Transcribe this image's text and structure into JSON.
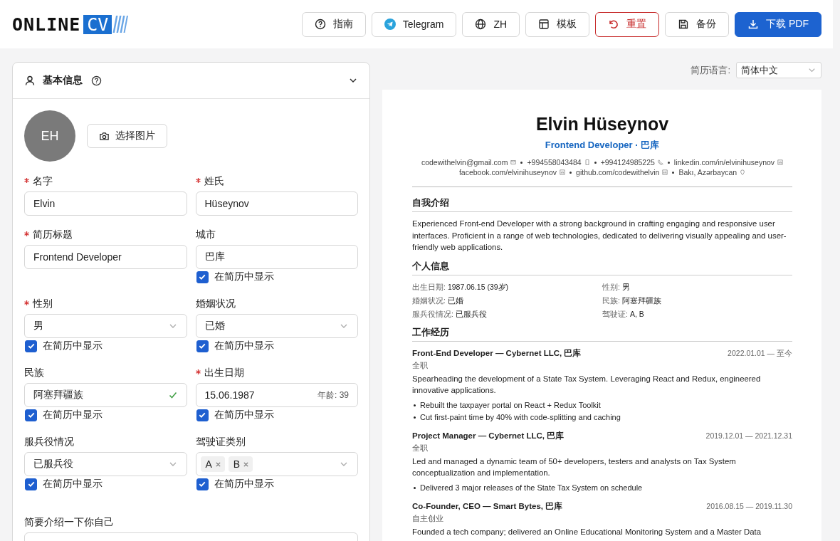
{
  "logo": {
    "text": "ONLINE",
    "highlight": "CV"
  },
  "toolbar": [
    {
      "label": "指南",
      "kind": "default"
    },
    {
      "label": "Telegram",
      "kind": "default"
    },
    {
      "label": "ZH",
      "kind": "default"
    },
    {
      "label": "模板",
      "kind": "default"
    },
    {
      "label": "重置",
      "kind": "danger"
    },
    {
      "label": "备份",
      "kind": "default"
    },
    {
      "label": "下载 PDF",
      "kind": "primary"
    }
  ],
  "card": {
    "title": "基本信息",
    "expanded": true,
    "avatar": "EH",
    "photo_button": "选择图片"
  },
  "form": {
    "fields": [
      {
        "label": "名字",
        "required": true,
        "kind": "text",
        "value": "Elvin",
        "valid": false
      },
      {
        "label": "姓氏",
        "required": true,
        "kind": "text",
        "value": "Hüseynov",
        "valid": false
      },
      {
        "label": "简历标题",
        "required": true,
        "kind": "text",
        "value": "Frontend Developer",
        "valid": false
      },
      {
        "label": "城市",
        "required": false,
        "kind": "text",
        "value": "巴库",
        "valid": false,
        "show": {
          "label": "在简历中显示",
          "checked": true
        }
      },
      {
        "label": "性别",
        "required": true,
        "kind": "select",
        "value": "男",
        "show": {
          "label": "在简历中显示",
          "checked": true
        }
      },
      {
        "label": "婚姻状况",
        "required": false,
        "kind": "select",
        "value": "已婚",
        "show": {
          "label": "在简历中显示",
          "checked": true
        }
      },
      {
        "label": "民族",
        "required": false,
        "kind": "text",
        "value": "阿塞拜疆族",
        "valid": true,
        "show": {
          "label": "在简历中显示",
          "checked": true
        }
      },
      {
        "label": "出生日期",
        "required": true,
        "kind": "date",
        "value": "15.06.1987",
        "age": "年龄: 39",
        "show": {
          "label": "在简历中显示",
          "checked": true
        }
      },
      {
        "label": "服兵役情况",
        "required": false,
        "kind": "select",
        "value": "已服兵役",
        "show": {
          "label": "在简历中显示",
          "checked": true
        }
      },
      {
        "label": "驾驶证类别",
        "required": false,
        "kind": "tags",
        "tags": [
          "A",
          "B"
        ],
        "show": {
          "label": "在简历中显示",
          "checked": true
        }
      },
      {
        "label": "简要介绍一下你自己",
        "required": false,
        "kind": "textarea",
        "full": true
      }
    ]
  },
  "cv_language": {
    "label": "简历语言:",
    "value": "简体中文"
  },
  "cv": {
    "name": "Elvin Hüseynov",
    "title": "Frontend Developer · 巴库",
    "contact_lines": [
      [
        {
          "text": "codewithelvin@gmail.com",
          "kind": "email"
        },
        {
          "text": "+994558043484",
          "kind": "mobile"
        },
        {
          "text": "+994124985225",
          "kind": "phone"
        },
        {
          "text": "linkedin.com/in/elvinihuseynov",
          "kind": "linkedin"
        }
      ],
      [
        {
          "text": "facebook.com/elvinihuseynov",
          "kind": "facebook"
        },
        {
          "text": "github.com/codewithelvin",
          "kind": "github"
        },
        {
          "text": "Bakı, Azərbaycan",
          "kind": "location"
        }
      ]
    ],
    "sections": [
      {
        "kind": "text",
        "title": "自我介绍",
        "text": "Experienced Front-end Developer with a strong background in crafting engaging and responsive user interfaces. Proficient in a range of web technologies, dedicated to delivering visually appealing and user-friendly web applications."
      },
      {
        "kind": "info",
        "title": "个人信息",
        "items": [
          {
            "label": "出生日期:",
            "value": "1987.06.15 (39岁)"
          },
          {
            "label": "性别:",
            "value": "男"
          },
          {
            "label": "婚姻状况:",
            "value": "已婚"
          },
          {
            "label": "民族:",
            "value": "阿塞拜疆族"
          },
          {
            "label": "服兵役情况:",
            "value": "已服兵役"
          },
          {
            "label": "驾驶证:",
            "value": "A, B"
          }
        ]
      },
      {
        "kind": "jobs",
        "title": "工作经历",
        "jobs": [
          {
            "title": "Front-End Developer — Cybernet LLC, 巴库",
            "dates": "2022.01.01 — 至今",
            "type": "全职",
            "description": "Spearheading the development of a State Tax System. Leveraging React and Redux, engineered innovative applications.",
            "bullets": [
              "Rebuilt the taxpayer portal on React + Redux Toolkit",
              "Cut first-paint time by 40% with code-splitting and caching"
            ]
          },
          {
            "title": "Project Manager — Cybernet LLC, 巴库",
            "dates": "2019.12.01 — 2021.12.31",
            "type": "全职",
            "description": "Led and managed a dynamic team of 50+ developers, testers and analysts on Tax System conceptualization and implementation.",
            "bullets": [
              "Delivered 3 major releases of the State Tax System on schedule"
            ]
          },
          {
            "title": "Co-Founder, CEO — Smart Bytes, 巴库",
            "dates": "2016.08.15 — 2019.11.30",
            "type": "自主创业",
            "description": "Founded a tech company; delivered an Online Educational Monitoring System and a Master Data"
          }
        ]
      }
    ]
  }
}
